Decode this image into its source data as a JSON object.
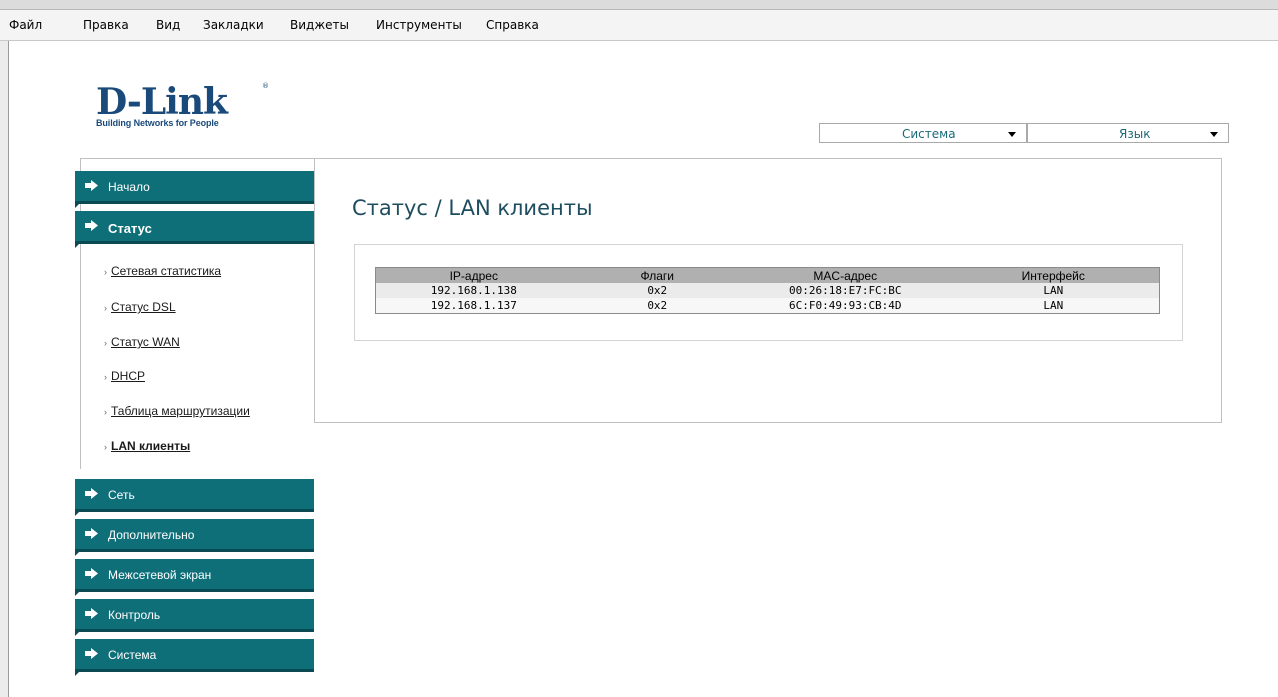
{
  "menu": [
    "Файл",
    "Правка",
    "Вид",
    "Закладки",
    "Виджеты",
    "Инструменты",
    "Справка"
  ],
  "logo": {
    "brand": "D-Link",
    "reg": "®",
    "tagline": "Building Networks for People"
  },
  "selects": {
    "system": "Система",
    "language": "Язык"
  },
  "sidebar": {
    "nav": [
      "Начало",
      "Статус",
      "Сеть",
      "Дополнительно",
      "Межсетевой экран",
      "Контроль",
      "Система"
    ],
    "status_sub": [
      "Сетевая статистика",
      "Статус DSL",
      "Статус WAN",
      "DHCP",
      "Таблица маршрутизации",
      "LAN клиенты"
    ]
  },
  "page": {
    "title": "Статус / LAN клиенты"
  },
  "table": {
    "headers": [
      "IP-адрес",
      "Флаги",
      "MAC-адрес",
      "Интерфейс"
    ],
    "rows": [
      [
        "192.168.1.138",
        "0x2",
        "00:26:18:E7:FC:BC",
        "LAN"
      ],
      [
        "192.168.1.137",
        "0x2",
        "6C:F0:49:93:CB:4D",
        "LAN"
      ]
    ]
  },
  "colors": {
    "nav_bg": "#0f6f79",
    "nav_shadow": "#0b4a52",
    "title": "#1d4d5e",
    "logo": "#1a4a7a"
  }
}
